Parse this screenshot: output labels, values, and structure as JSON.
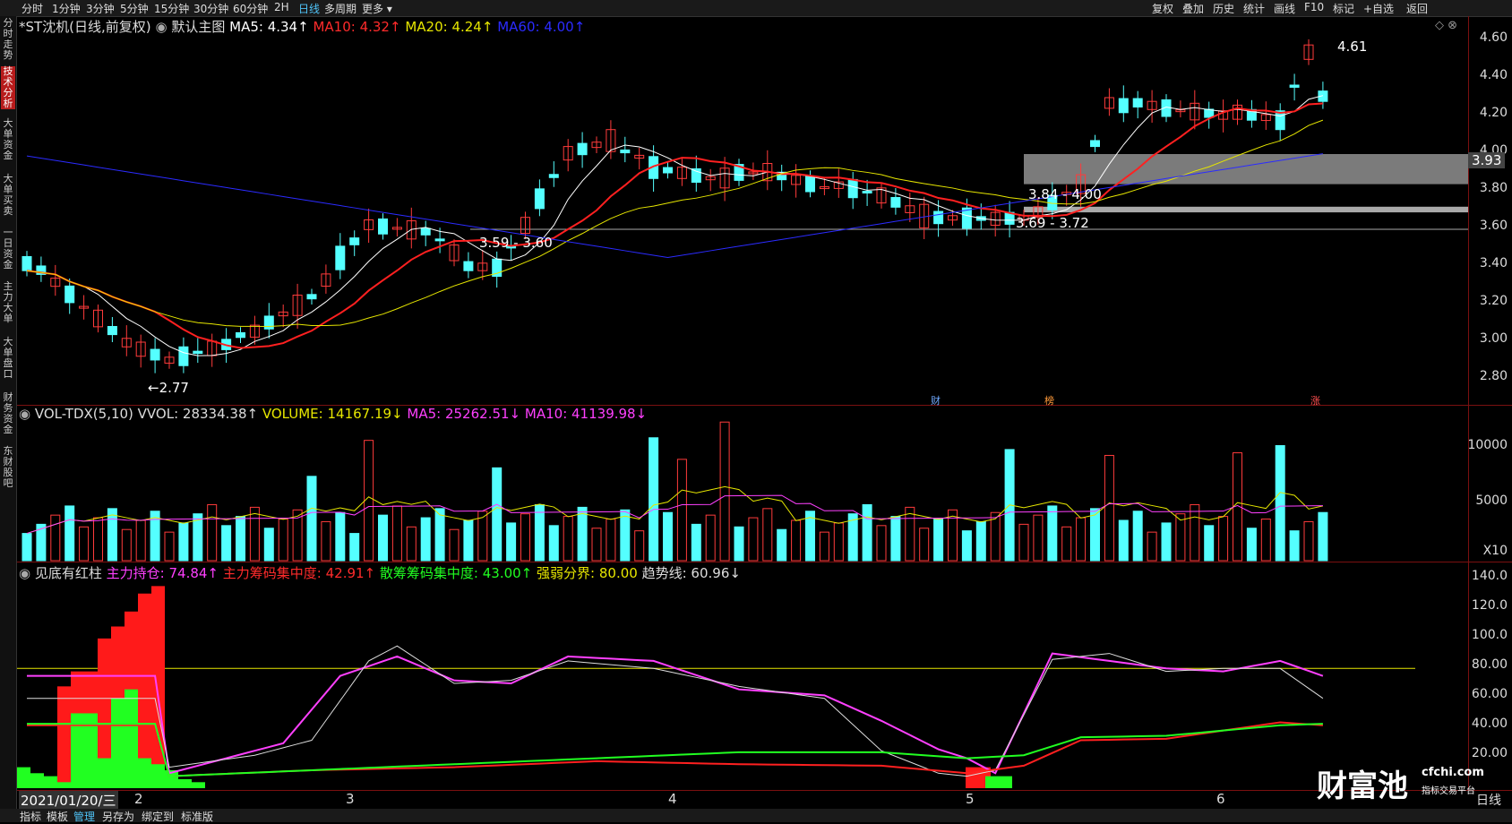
{
  "toolbar": {
    "periods": [
      "分时",
      "1分钟",
      "3分钟",
      "5分钟",
      "15分钟",
      "30分钟",
      "60分钟",
      "2H",
      "日线",
      "多周期",
      "更多"
    ],
    "active_period": "日线",
    "right_tools": [
      "复权",
      "叠加",
      "历史",
      "统计",
      "画线",
      "F10",
      "标记",
      "+自选",
      "返回"
    ]
  },
  "left_nav": [
    "分时走势",
    "技术分析",
    "大单资金",
    "大单买卖",
    "一日资金",
    "主力大单",
    "大单盘口",
    "财务资金",
    "东财股吧"
  ],
  "left_nav_active": "技术分析",
  "main": {
    "title": "*ST沈机(日线,前复权)",
    "indicator": "默认主图",
    "ma5": "MA5: 4.34↑",
    "ma10": "MA10: 4.32↑",
    "ma20": "MA20: 4.24↑",
    "ma60": "MA60: 4.00↑",
    "price_ticks": [
      "4.60",
      "4.40",
      "4.20",
      "4.00",
      "3.80",
      "3.60",
      "3.40",
      "3.20",
      "3.00",
      "2.80"
    ],
    "annotations": {
      "high": "4.61",
      "low": "←2.77",
      "zone1": "3.59 - 3.60",
      "zone2": "3.84 - 4.00",
      "zone3": "3.69 - 3.72",
      "zone_value": "3.93"
    },
    "markers": [
      "财",
      "榜",
      "涨"
    ]
  },
  "volume": {
    "title": "VOL-TDX(5,10) VVOL: 28334.38↑",
    "volume": "VOLUME: 14167.19↓",
    "ma5": "MA5: 25262.51↓",
    "ma10": "MA10: 41139.98↓",
    "ticks": [
      "10000",
      "5000",
      "X10"
    ]
  },
  "indicator": {
    "title": "见底有红柱",
    "zl_hold": "主力持仓: 74.84↑",
    "zl_conc": "主力筹码集中度: 42.91↑",
    "sc_conc": "散筹筹码集中度: 43.00↑",
    "strong_weak": "强弱分界: 80.00",
    "trend": "趋势线: 60.96↓",
    "ticks": [
      "140.0",
      "120.0",
      "100.0",
      "80.00",
      "60.00",
      "40.00",
      "20.00"
    ]
  },
  "x_axis": {
    "date": "2021/01/20/三",
    "months": [
      "2",
      "3",
      "4",
      "5",
      "6"
    ],
    "period_label": "日线"
  },
  "bottom_tabs": [
    "指标",
    "模板",
    "管理",
    "另存为",
    "绑定到",
    "标准版"
  ],
  "bottom_active": "管理",
  "watermark": {
    "brand": "财富池",
    "site": "cfchi.com",
    "slogan": "指标交易平台"
  },
  "colors": {
    "up": "#ff3b3b",
    "down": "#54ffff",
    "ma5": "#ffffff",
    "ma10": "#ff2020",
    "ma20": "#e6e600",
    "ma60": "#2b2bff",
    "magenta": "#ff40ff",
    "green": "#21ff21"
  }
}
